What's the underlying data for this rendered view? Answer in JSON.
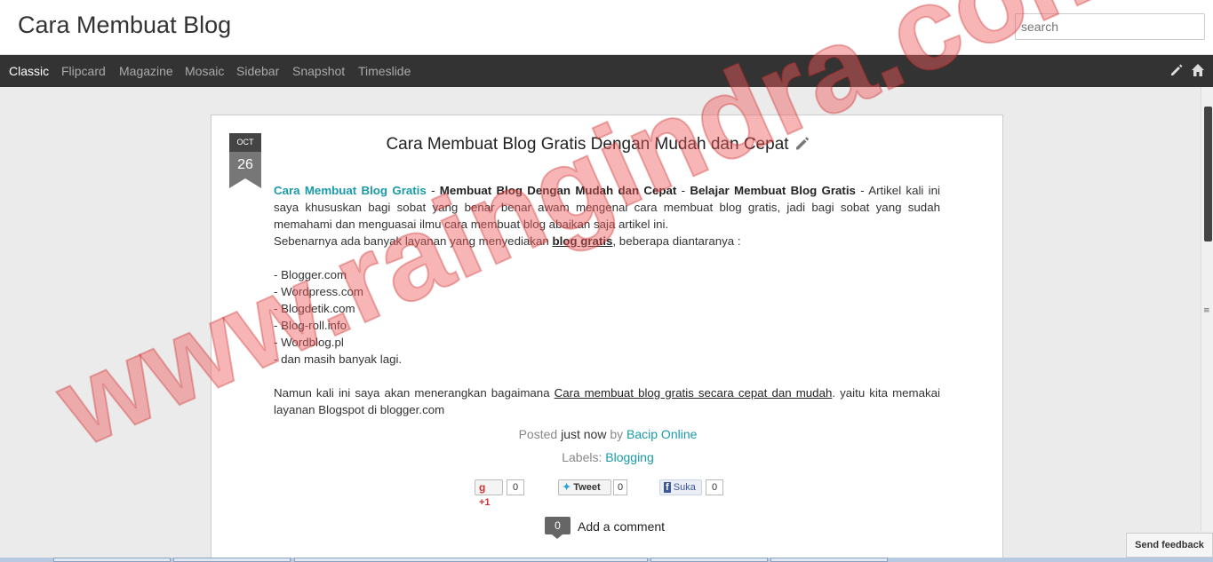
{
  "header": {
    "blog_title": "Cara Membuat Blog",
    "search_placeholder": "search"
  },
  "nav": {
    "items": [
      "Classic",
      "Flipcard",
      "Magazine",
      "Mosaic",
      "Sidebar",
      "Snapshot",
      "Timeslide"
    ],
    "active": "Classic",
    "icons": [
      "pencil-icon",
      "home-icon"
    ]
  },
  "post": {
    "date_month": "OCT",
    "date_day": "26",
    "title": "Cara Membuat Blog Gratis Dengan Mudah dan Cepat",
    "intro_link": "Cara Membuat Blog Gratis",
    "sep1": " - ",
    "intro_strong1": "Membuat Blog Dengan Mudah dan Cepat",
    "sep2": " - ",
    "intro_strong2": "Belajar Membuat Blog Gratis",
    "intro_rest": " - Artikel kali ini saya khususkan bagi sobat yang benar benar awam mengenai cara membuat blog gratis, jadi bagi sobat yang sudah memahami dan menguasai ilmu cara membuat blog abaikan saja artikel ini.",
    "line2_pre": "Sebenarnya ada banyak layanan yang menyediakan ",
    "line2_link": "blog gratis",
    "line2_post": ", beberapa diantaranya :",
    "list": [
      "- Blogger.com",
      "- Wordpress.com",
      "- Blogdetik.com",
      "- Blog-roll.info",
      "- Wordblog.pl",
      "- dan masih banyak lagi."
    ],
    "closing_pre": "Namun kali ini saya akan menerangkan bagaimana ",
    "closing_link": "Cara membuat blog gratis secara cepat dan mudah",
    "closing_post": ". yaitu kita memakai layanan Blogspot di blogger.com",
    "posted_label": "Posted",
    "posted_time": "just now",
    "posted_by": "by",
    "author": "Bacip Online",
    "labels_label": "Labels:",
    "label_value": "Blogging",
    "share": {
      "gplus_label": "+1",
      "gplus_count": "0",
      "tweet_label": "Tweet",
      "tweet_count": "0",
      "fb_label": "Suka",
      "fb_count": "0"
    },
    "comment_count": "0",
    "comment_label": "Add a comment"
  },
  "watermark": "www.raingindra.com",
  "feedback_label": "Send feedback",
  "colors": {
    "accent": "#1a9aa8",
    "navbar": "#333333",
    "watermark": "#f07a7a"
  }
}
